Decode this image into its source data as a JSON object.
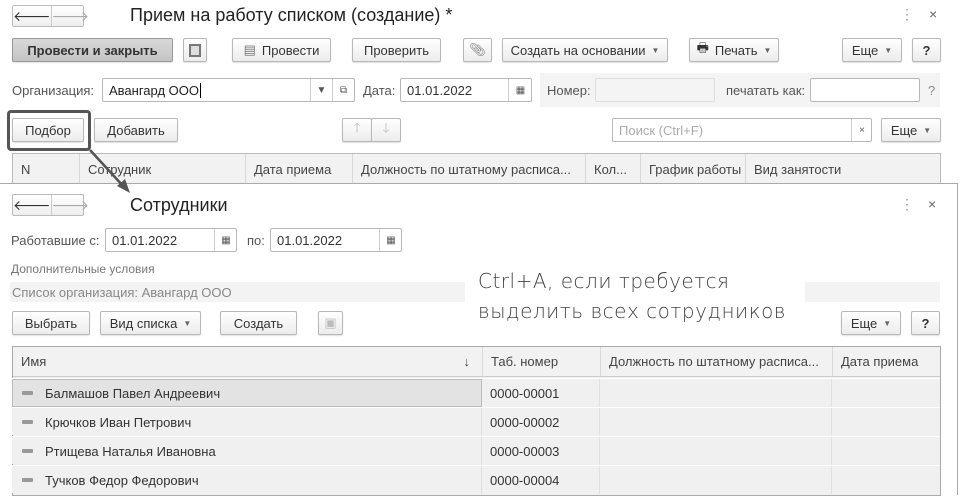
{
  "main_window": {
    "title": "Прием на работу списком (создание) *",
    "toolbar": {
      "post_close": "Провести и закрыть",
      "post": "Провести",
      "check": "Проверить",
      "create_based": "Создать на основании",
      "print": "Печать",
      "more": "Еще",
      "help": "?"
    },
    "org_label": "Организация:",
    "org_value": "Авангард ООО",
    "date_label": "Дата:",
    "date_value": "01.01.2022",
    "number_label": "Номер:",
    "number_value": "",
    "print_as_label": "печатать как:",
    "print_as_value": "",
    "hint": "?",
    "select_button": "Подбор",
    "add_button": "Добавить",
    "search_placeholder": "Поиск (Ctrl+F)",
    "more2": "Еще",
    "columns": [
      "N",
      "Сотрудник",
      "Дата приема",
      "Должность по штатному расписа...",
      "Кол...",
      "График работы",
      "Вид занятости"
    ]
  },
  "picker": {
    "title": "Сотрудники",
    "worked_from_label": "Работавшие с:",
    "worked_from": "01.01.2022",
    "to_label": "по:",
    "to": "01.01.2022",
    "extra_conditions": "Дополнительные условия",
    "org_filter": "Список организация: Авангард ООО",
    "choose": "Выбрать",
    "list_view": "Вид списка",
    "create": "Создать",
    "more": "Еще",
    "help": "?",
    "columns": [
      "Имя",
      "Таб. номер",
      "Должность по штатному расписа...",
      "Дата приема"
    ],
    "sort_indicator": "↓",
    "rows": [
      {
        "name": "Балмашов Павел Андреевич",
        "tab": "0000-00001",
        "position": "",
        "date": ""
      },
      {
        "name": "Крючков Иван Петрович",
        "tab": "0000-00002",
        "position": "",
        "date": ""
      },
      {
        "name": "Ртищева Наталья Ивановна",
        "tab": "0000-00003",
        "position": "",
        "date": ""
      },
      {
        "name": "Тучков Федор Федорович",
        "tab": "0000-00004",
        "position": "",
        "date": ""
      }
    ]
  },
  "annotation": {
    "line1": "Ctrl+A, если требуется",
    "line2": "выделить всех сотрудников"
  }
}
